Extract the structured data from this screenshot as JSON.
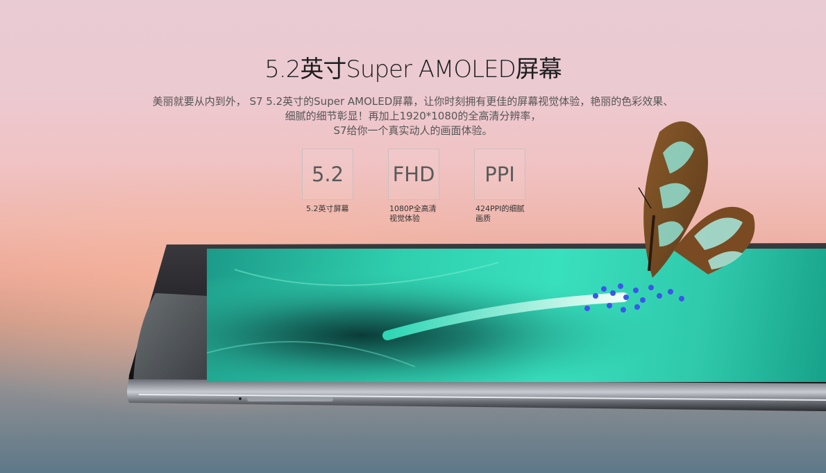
{
  "header": {
    "title": "5.2英寸Super AMOLED屏幕"
  },
  "description": {
    "line1": "美丽就要从内到外， S7  5.2英寸的Super AMOLED屏幕，让你时刻拥有更佳的屏幕视觉体验，艳丽的色彩效果、",
    "line2": "细腻的细节彰显！再加上1920*1080的全高清分辨率，",
    "line3": "S7给你一个真实动人的画面体验。"
  },
  "features": [
    {
      "value": "5.2",
      "caption": "5.2英寸屏幕"
    },
    {
      "value": "FHD",
      "caption": "1080P全高清视觉体验"
    },
    {
      "value": "PPI",
      "caption": "424PPI的细腻画质"
    }
  ],
  "colors": {
    "accent_screen": "#2fcfae",
    "title": "#1e1e1e",
    "text": "#555555"
  }
}
